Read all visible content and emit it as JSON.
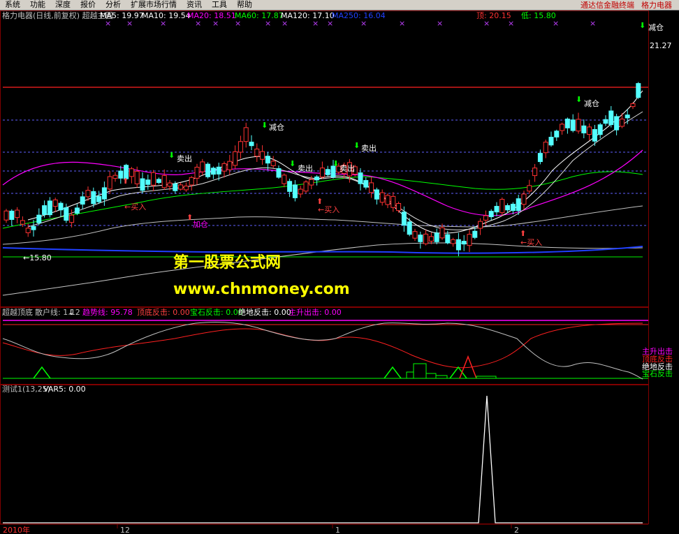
{
  "menu": {
    "items": [
      "系统",
      "功能",
      "深度",
      "报价",
      "分析",
      "扩展市场行情",
      "资讯",
      "工具",
      "帮助"
    ],
    "brand1": "通达信金融终端",
    "brand2": "格力电器"
  },
  "main": {
    "title": "格力电器(日线,前复权) 超越主图",
    "ma": [
      {
        "label": "MA5: 19.97",
        "color": "#ffffff"
      },
      {
        "label": "MA10: 19.54",
        "color": "#ffffff"
      },
      {
        "label": "MA20: 18.51",
        "color": "#ff00ff"
      },
      {
        "label": "MA60: 17.87",
        "color": "#00ff00"
      },
      {
        "label": "MA120: 17.10",
        "color": "#ffffff"
      },
      {
        "label": "MA250: 16.04",
        "color": "#2040ff"
      }
    ],
    "top_label": "顶: 20.15",
    "bottom_label": "低: 15.80",
    "high_price": "21.27",
    "low_price": "←15.80",
    "signals": [
      {
        "text": "减仓",
        "kind": "sell"
      },
      {
        "text": "减仓",
        "kind": "sell"
      },
      {
        "text": "卖出",
        "kind": "sell"
      },
      {
        "text": "卖出",
        "kind": "sell"
      },
      {
        "text": "卖出",
        "kind": "sell"
      },
      {
        "text": "卖出",
        "kind": "sell"
      },
      {
        "text": "减仓",
        "kind": "sell"
      },
      {
        "text": "←买入",
        "kind": "buy"
      },
      {
        "text": "加仓",
        "kind": "buy"
      },
      {
        "text": "←买入",
        "kind": "buy"
      },
      {
        "text": "←买入",
        "kind": "buy"
      }
    ],
    "watermark1": "第一股票公式网",
    "watermark2": "www.chnmoney.com"
  },
  "sub1": {
    "title": "超越顶底",
    "items": [
      {
        "label": "散户线: 1.12",
        "color": "#c0c0c0"
      },
      {
        "label": "趋势线: 95.78",
        "color": "#ff00ff"
      },
      {
        "label": "顶底反击: 0.00",
        "color": "#ff4040"
      },
      {
        "label": "宝石反击: 0.00",
        "color": "#00ff00"
      },
      {
        "label": "绝地反击: 0.00",
        "color": "#ffffff"
      },
      {
        "label": "主升出击: 0.00",
        "color": "#ff00ff"
      }
    ],
    "legend": [
      {
        "label": "主升出击",
        "color": "#ff00ff"
      },
      {
        "label": "顶底反击",
        "color": "#ff2020"
      },
      {
        "label": "绝地反击",
        "color": "#ffffff"
      },
      {
        "label": "宝石反击",
        "color": "#00ff00"
      }
    ]
  },
  "sub2": {
    "title": "测试1(13,25)",
    "var": "VAR5: 0.00"
  },
  "xaxis": {
    "labels": [
      "2010年",
      "12",
      "1",
      "2"
    ]
  }
}
